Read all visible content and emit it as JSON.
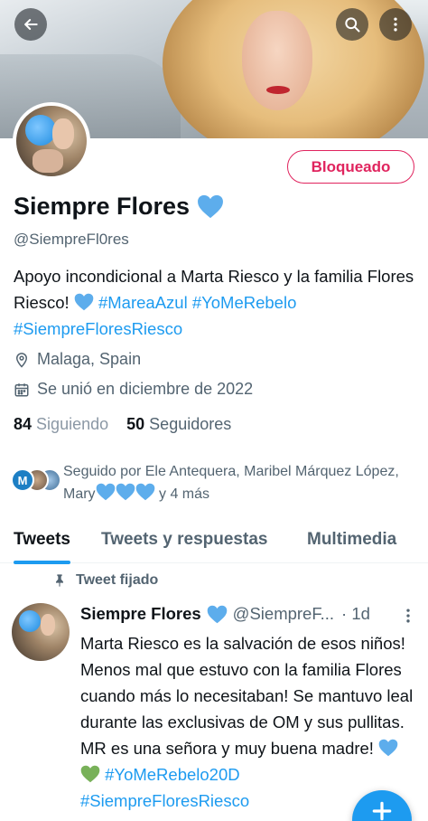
{
  "header": {
    "back_icon": "arrow-left-icon",
    "search_icon": "search-icon",
    "more_icon": "more-vertical-icon"
  },
  "profile": {
    "display_name": "Siempre Flores",
    "name_emoji": "blue-heart-icon",
    "handle": "@SiempreFl0res",
    "blocked_label": "Bloqueado",
    "bio_text": "Apoyo incondicional a Marta Riesco y la familia Flores Riesco! ",
    "bio_hashtags": [
      "#MareaAzul",
      "#YoMeRebelo",
      "#SiempreFloresRiesco"
    ],
    "location": "Malaga, Spain",
    "joined": "Se unió en diciembre de 2022",
    "following_count": "84",
    "following_label": "Siguiendo",
    "followers_count": "50",
    "followers_label": "Seguidores",
    "followed_by_prefix": "Seguido por Ele Antequera, Maribel Márquez López, Mary",
    "followed_by_suffix": " y 4 más",
    "mini_avatar_letter": "M"
  },
  "tabs": [
    {
      "label": "Tweets",
      "active": true
    },
    {
      "label": "Tweets y respuestas",
      "active": false
    },
    {
      "label": "Multimedia",
      "active": false
    }
  ],
  "pinned_tweet": {
    "pinned_label": "Tweet fijado",
    "author_name": "Siempre Flores",
    "author_handle": "@SiempreF...",
    "time": "· 1d",
    "text": "Marta Riesco es la salvación de esos niños! Menos mal que estuvo con la familia Flores cuando más lo necesitaban! Se mantuvo leal durante las exclusivas de OM y sus pullitas. MR es una señora y muy buena madre! ",
    "hashtag_1": "#YoMeRebelo20D",
    "hashtag_2": "#SiempreFloresRiesco"
  },
  "colors": {
    "accent": "#1d9bf0",
    "blocked": "#e0245e",
    "secondary_text": "#536471",
    "green_heart": "#78b159",
    "blue_heart": "#5dadec"
  },
  "fab": {
    "icon": "compose-plus-icon"
  }
}
